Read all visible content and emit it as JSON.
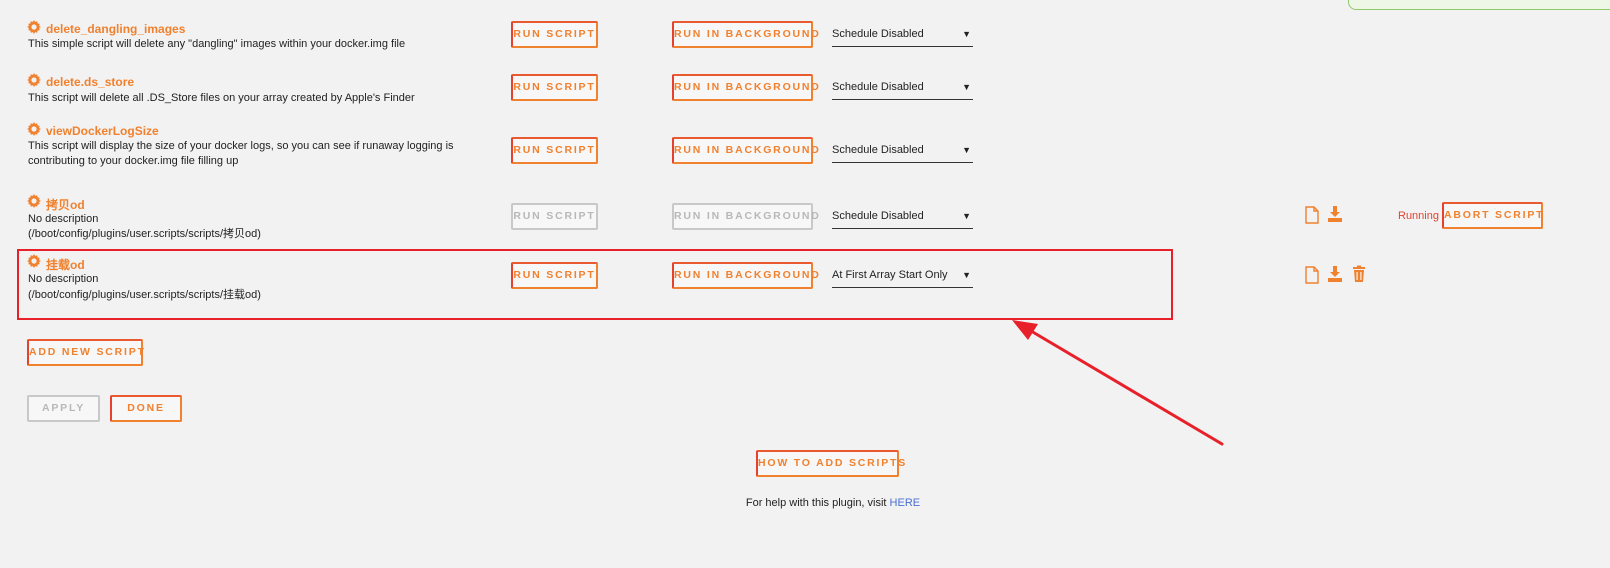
{
  "scripts": [
    {
      "name": "delete_dangling_images",
      "description": [
        "This simple script will delete any \"dangling\" images within your docker.img file"
      ],
      "run_label": "RUN SCRIPT",
      "bg_label": "RUN IN BACKGROUND",
      "schedule": "Schedule Disabled"
    },
    {
      "name": "delete.ds_store",
      "description": [
        "This script will delete all .DS_Store files on your array created by Apple's Finder"
      ],
      "run_label": "RUN SCRIPT",
      "bg_label": "RUN IN BACKGROUND",
      "schedule": "Schedule Disabled"
    },
    {
      "name": "viewDockerLogSize",
      "description": [
        "This script will display the size of your docker logs, so you can see if runaway logging is",
        "contributing to your docker.img file filling up"
      ],
      "run_label": "RUN SCRIPT",
      "bg_label": "RUN IN BACKGROUND",
      "schedule": "Schedule Disabled"
    },
    {
      "name": "拷贝od",
      "description": [
        "No description",
        "(/boot/config/plugins/user.scripts/scripts/拷贝od)"
      ],
      "run_label": "RUN SCRIPT",
      "bg_label": "RUN IN BACKGROUND",
      "schedule": "Schedule Disabled",
      "status": "Running",
      "abort_label": "ABORT SCRIPT"
    },
    {
      "name": "挂载od",
      "description": [
        "No description",
        "(/boot/config/plugins/user.scripts/scripts/挂载od)"
      ],
      "run_label": "RUN SCRIPT",
      "bg_label": "RUN IN BACKGROUND",
      "schedule": "At First Array Start Only"
    }
  ],
  "actions": {
    "add_new_script": "ADD NEW SCRIPT",
    "apply": "APPLY",
    "done": "DONE",
    "how_to_add": "HOW TO ADD SCRIPTS"
  },
  "help": {
    "text": "For help with this plugin, visit ",
    "link": "HERE"
  },
  "colors": {
    "accent": "#f0812f",
    "accent_red": "#e4422e",
    "annotation": "#e8202a",
    "link": "#4a6fd6"
  },
  "icons": [
    "gear-icon",
    "file-icon",
    "download-icon",
    "trash-icon",
    "dropdown-arrow-icon"
  ]
}
